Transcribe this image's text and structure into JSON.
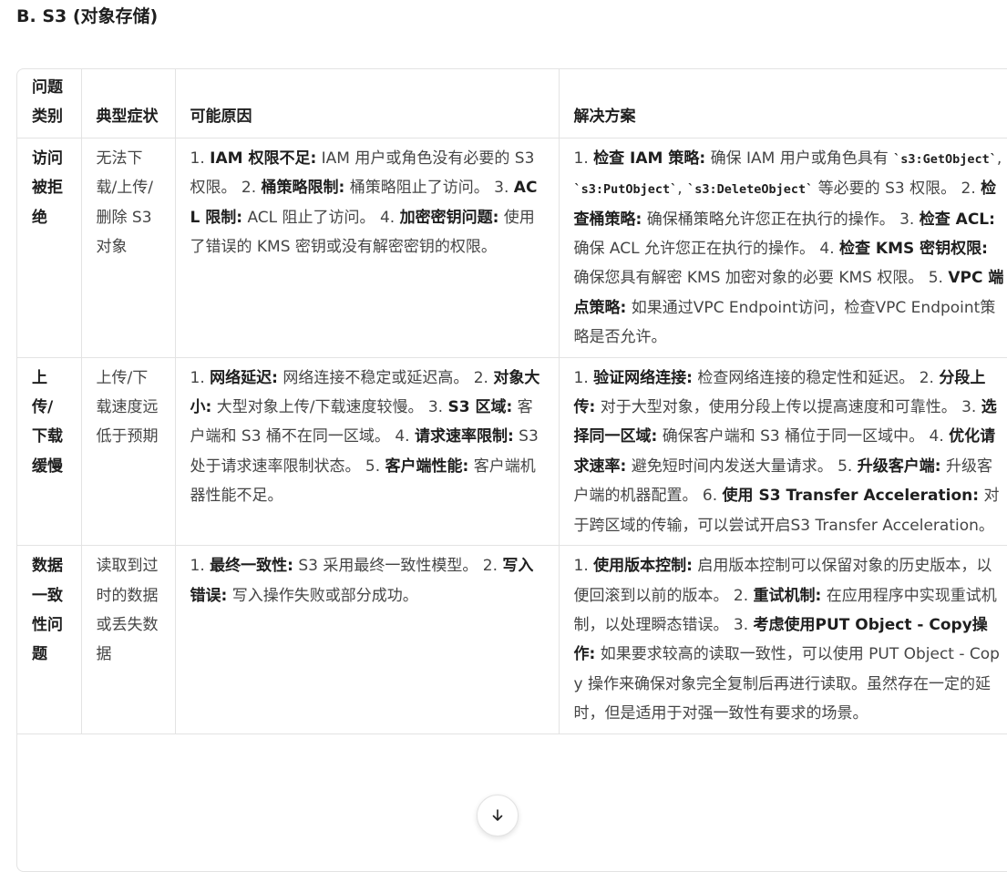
{
  "section_title": "B. S3 (对象存储)",
  "table": {
    "headers": [
      "问题类别",
      "典型症状",
      "可能原因",
      "解决方案"
    ],
    "rows": [
      {
        "category": "访问被拒绝",
        "symptom": "无法下载/上传/删除 S3 对象",
        "causes_html": "1. <b>IAM 权限不足:</b> IAM 用户或角色没有必要的 S3 权限。 2. <b>桶策略限制:</b> 桶策略阻止了访问。 3. <b>ACL 限制:</b> ACL 阻止了访问。 4. <b>加密密钥问题:</b> 使用了错误的 KMS 密钥或没有解密密钥的权限。",
        "solutions_html": "1. <b>检查 IAM 策略:</b> 确保 IAM 用户或角色具有 <code>`s3:GetObject`</code>, <code>`s3:PutObject`</code>, <code>`s3:DeleteObject`</code> 等必要的 S3 权限。 2. <b>检查桶策略:</b> 确保桶策略允许您正在执行的操作。 3. <b>检查 ACL:</b> 确保 ACL 允许您正在执行的操作。 4. <b>检查 KMS 密钥权限:</b> 确保您具有解密 KMS 加密对象的必要 KMS 权限。 5. <b>VPC 端点策略:</b> 如果通过VPC Endpoint访问，检查VPC Endpoint策略是否允许。"
      },
      {
        "category": "上传/下载缓慢",
        "symptom": "上传/下载速度远低于预期",
        "causes_html": "1. <b>网络延迟:</b> 网络连接不稳定或延迟高。 2. <b>对象大小:</b> 大型对象上传/下载速度较慢。 3. <b>S3 区域:</b> 客户端和 S3 桶不在同一区域。 4. <b>请求速率限制:</b> S3 处于请求速率限制状态。 5. <b>客户端性能:</b> 客户端机器性能不足。",
        "solutions_html": "1. <b>验证网络连接:</b> 检查网络连接的稳定性和延迟。 2. <b>分段上传:</b> 对于大型对象，使用分段上传以提高速度和可靠性。 3. <b>选择同一区域:</b> 确保客户端和 S3 桶位于同一区域中。 4. <b>优化请求速率:</b> 避免短时间内发送大量请求。 5. <b>升级客户端:</b> 升级客户端的机器配置。 6. <b>使用 S3 Transfer Acceleration:</b> 对于跨区域的传输，可以尝试开启S3 Transfer Acceleration。"
      },
      {
        "category": "数据一致性问题",
        "symptom": "读取到过时的数据或丢失数据",
        "causes_html": "1. <b>最终一致性:</b> S3 采用最终一致性模型。 2. <b>写入错误:</b> 写入操作失败或部分成功。",
        "solutions_html": "1. <b>使用版本控制:</b> 启用版本控制可以保留对象的历史版本，以便回滚到以前的版本。 2. <b>重试机制:</b> 在应用程序中实现重试机制，以处理瞬态错误。 3. <b>考虑使用PUT Object - Copy操作:</b> 如果要求较高的读取一致性，可以使用 PUT Object - Copy 操作来确保对象完全复制后再进行读取。虽然存在一定的延时，但是适用于对强一致性有要求的场景。"
      }
    ]
  },
  "scroll_button_icon": "arrow-down-icon"
}
